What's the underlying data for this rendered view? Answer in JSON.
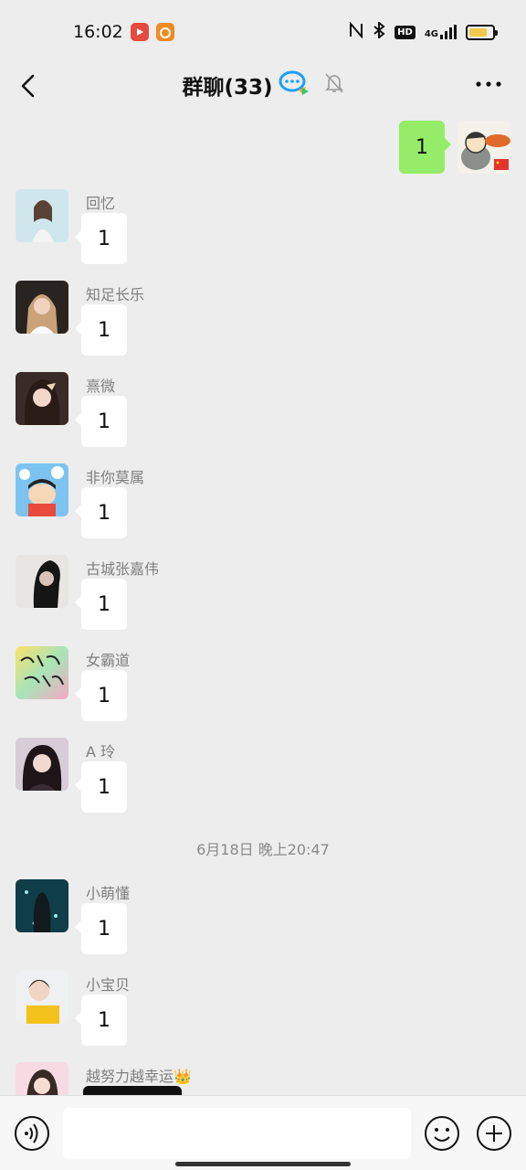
{
  "status": {
    "time": "16:02",
    "hd": "HD",
    "network": "4G",
    "battery_level": 0.8
  },
  "header": {
    "title": "群聊(33)"
  },
  "outgoing": {
    "text": "1"
  },
  "messages_before": [
    {
      "sender": "回忆",
      "text": "1"
    },
    {
      "sender": "知足长乐",
      "text": "1"
    },
    {
      "sender": "熹微",
      "text": "1"
    },
    {
      "sender": "非你莫属",
      "text": "1"
    },
    {
      "sender": "古城张嘉伟",
      "text": "1"
    },
    {
      "sender": "女霸道",
      "text": "1"
    },
    {
      "sender": "A 玲",
      "text": "1"
    }
  ],
  "timestamp": "6月18日 晚上20:47",
  "messages_after": [
    {
      "sender": "小萌懂",
      "text": "1"
    },
    {
      "sender": "小宝贝",
      "text": "1"
    },
    {
      "sender": "越努力越幸运👑",
      "text": ""
    }
  ],
  "icons": {
    "back": "back-arrow-icon",
    "group_badge": "chat-bubble-icon",
    "mute": "bell-off-icon",
    "more": "more-dots-icon",
    "voice": "voice-icon",
    "emoji": "emoji-icon",
    "add": "plus-icon"
  },
  "colors": {
    "background": "#ededed",
    "outgoing_bubble": "#95ec69",
    "incoming_bubble": "#ffffff"
  }
}
